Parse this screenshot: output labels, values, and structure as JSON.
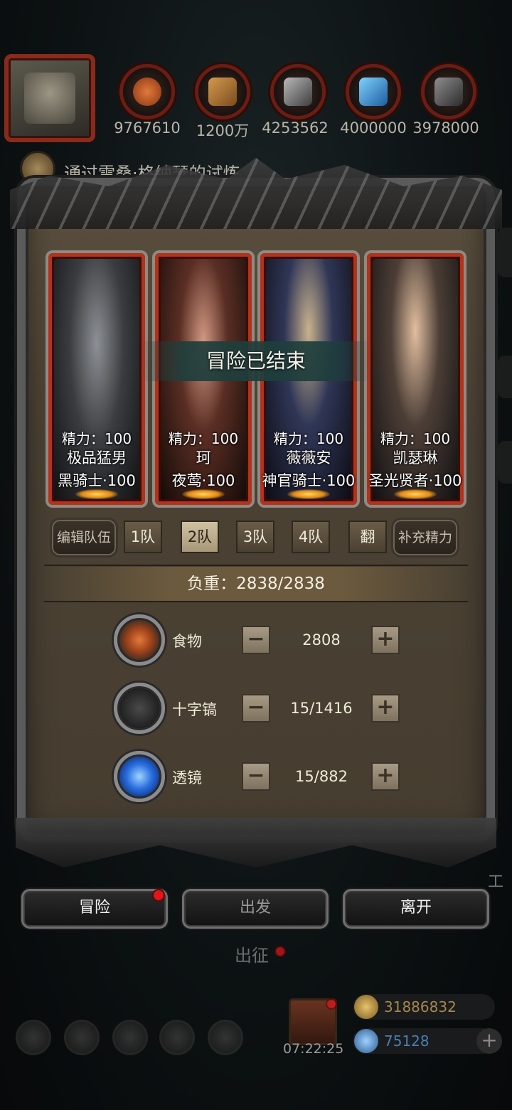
{
  "resources": [
    {
      "name": "meat-icon",
      "value": "9767610",
      "color": "#c45a26"
    },
    {
      "name": "wood-icon",
      "value": "1200万",
      "color": "#b27a3a"
    },
    {
      "name": "iron-icon",
      "value": "4253562",
      "color": "#7a7a7a"
    },
    {
      "name": "crystal-icon",
      "value": "4000000",
      "color": "#2f86c8"
    },
    {
      "name": "stone-icon",
      "value": "3978000",
      "color": "#5c5c5c"
    }
  ],
  "quest": {
    "text": "通过雷桑·格纳瑟的试炼"
  },
  "banner": {
    "text": "冒险已结束"
  },
  "heroes": [
    {
      "energy": "精力：100",
      "name": "极品猛男",
      "class": "黑骑士·100",
      "tint": "#4b4e52"
    },
    {
      "energy": "精力：100",
      "name": "珂",
      "class": "夜莺·100",
      "tint": "#6a3a2e"
    },
    {
      "energy": "精力：100",
      "name": "薇薇安",
      "class": "神官骑士·100",
      "tint": "#2e3656"
    },
    {
      "energy": "精力：100",
      "name": "凯瑟琳",
      "class": "圣光贤者·100",
      "tint": "#4a3e36"
    }
  ],
  "team": {
    "edit_label": "编辑队伍",
    "tabs": [
      "1队",
      "2队",
      "3队",
      "4队",
      "翻"
    ],
    "active_tab": "2队",
    "refill_label": "补充精力"
  },
  "load": {
    "text": "负重：2838/2838"
  },
  "supplies": [
    {
      "label": "食物",
      "value": "2808",
      "icon": "food-icon",
      "color": "#c65b24"
    },
    {
      "label": "十字镐",
      "value": "15/1416",
      "icon": "pickaxe-icon",
      "color": "#3b3b3b"
    },
    {
      "label": "透镜",
      "value": "15/882",
      "icon": "lens-icon",
      "color": "#2a6fe0"
    }
  ],
  "steppers": {
    "minus": "−",
    "plus": "+"
  },
  "actions": {
    "adventure": "冒险",
    "depart": "出发",
    "leave": "离开"
  },
  "sub_label": "出征",
  "footer": {
    "timer": "07:22:25",
    "gold": "31886832",
    "gems": "75128",
    "plus": "+",
    "gold_color": "#a4884e",
    "gem_color": "#4a7fb3"
  },
  "side_fragment": "工"
}
